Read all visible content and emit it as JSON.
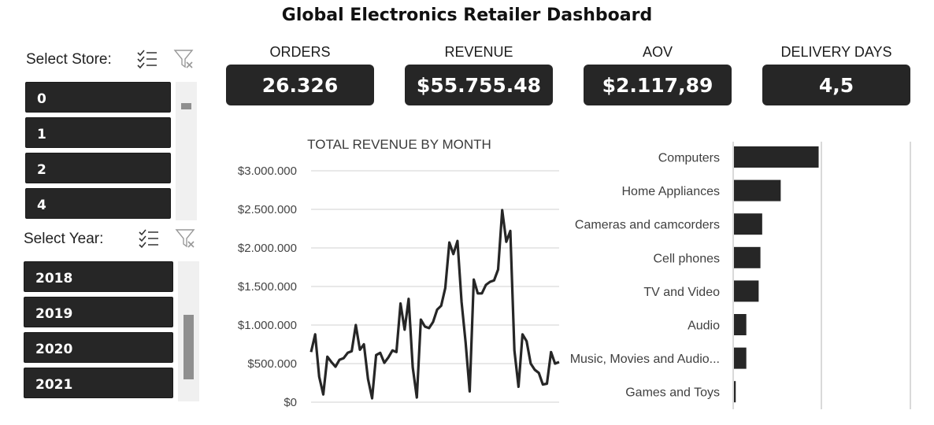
{
  "header": {
    "title": "Global Electronics Retailer Dashboard"
  },
  "store_slicer": {
    "label": "Select Store:",
    "items": [
      "0",
      "1",
      "2",
      "4"
    ],
    "icons": [
      "multi-select-icon",
      "clear-filter-icon"
    ]
  },
  "year_slicer": {
    "label": "Select Year:",
    "items": [
      "2018",
      "2019",
      "2020",
      "2021"
    ],
    "icons": [
      "multi-select-icon",
      "clear-filter-icon"
    ]
  },
  "kpis": [
    {
      "label": "ORDERS",
      "value": "26.326"
    },
    {
      "label": "REVENUE",
      "value": "$55.755.48"
    },
    {
      "label": "AOV",
      "value": "$2.117,89"
    },
    {
      "label": "DELIVERY DAYS",
      "value": "4,5"
    }
  ],
  "colors": {
    "card": "#262626",
    "line": "#262626",
    "grid": "#d9d9d9"
  },
  "chart_data": [
    {
      "type": "line",
      "title": "TOTAL REVENUE BY MONTH",
      "ylim": [
        0,
        3000000
      ],
      "y_ticks": [
        0,
        500000,
        1000000,
        1500000,
        2000000,
        2500000,
        3000000
      ],
      "y_tick_labels": [
        "$0",
        "$500.000",
        "$1.000.000",
        "$1.500.000",
        "$2.000.000",
        "$2.500.000",
        "$3.000.000"
      ],
      "grid": true,
      "series": [
        {
          "values": [
            650000,
            880000,
            330000,
            100000,
            590000,
            520000,
            460000,
            550000,
            570000,
            640000,
            660000,
            1000000,
            680000,
            750000,
            300000,
            50000,
            610000,
            640000,
            510000,
            580000,
            670000,
            650000,
            1280000,
            940000,
            1340000,
            450000,
            60000,
            1070000,
            980000,
            960000,
            1040000,
            1200000,
            1250000,
            1480000,
            2070000,
            1920000,
            2090000,
            1300000,
            780000,
            140000,
            1590000,
            1410000,
            1410000,
            1520000,
            1560000,
            1580000,
            1720000,
            2490000,
            2080000,
            2220000,
            670000,
            200000,
            880000,
            790000,
            500000,
            420000,
            380000,
            230000,
            240000,
            650000,
            500000,
            520000
          ]
        }
      ]
    },
    {
      "type": "bar",
      "orientation": "horizontal",
      "categories": [
        "Computers",
        "Home Appliances",
        "Cameras and camcorders",
        "Cell phones",
        "TV and Video",
        "Audio",
        "Music, Movies and Audio...",
        "Games and Toys"
      ],
      "values": [
        19.2,
        10.6,
        6.4,
        6.0,
        5.6,
        2.8,
        2.8,
        0.4
      ],
      "xlim": [
        0,
        40
      ]
    }
  ]
}
